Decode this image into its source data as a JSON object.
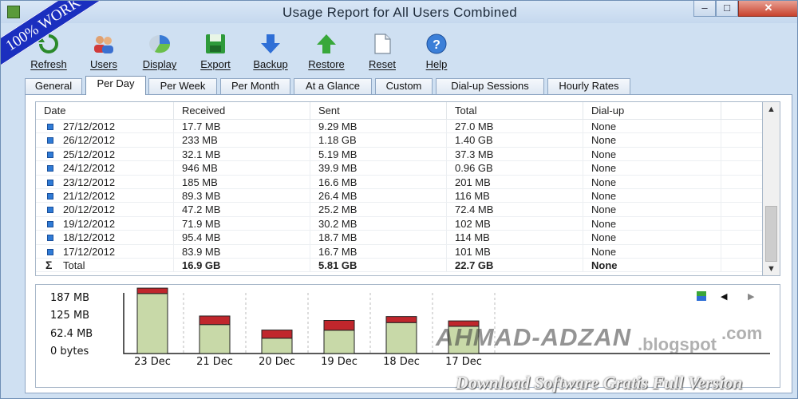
{
  "window": {
    "title": "Usage Report for All Users Combined",
    "min": "–",
    "max": "□",
    "close": "✕"
  },
  "badge": "100% WORK",
  "toolbar": [
    {
      "label": "Refresh",
      "icon": "refresh-icon"
    },
    {
      "label": "Users",
      "icon": "users-icon"
    },
    {
      "label": "Display",
      "icon": "display-icon"
    },
    {
      "label": "Export",
      "icon": "export-icon"
    },
    {
      "label": "Backup",
      "icon": "backup-icon"
    },
    {
      "label": "Restore",
      "icon": "restore-icon"
    },
    {
      "label": "Reset",
      "icon": "reset-icon"
    },
    {
      "label": "Help",
      "icon": "help-icon"
    }
  ],
  "tabs": [
    "General",
    "Per Day",
    "Per Week",
    "Per Month",
    "At a Glance",
    "Custom",
    "Dial-up Sessions",
    "Hourly Rates"
  ],
  "active_tab": "Per Day",
  "table": {
    "columns": [
      "Date",
      "Received",
      "Sent",
      "Total",
      "Dial-up"
    ],
    "rows": [
      [
        "27/12/2012",
        "17.7 MB",
        "9.29 MB",
        "27.0 MB",
        "None"
      ],
      [
        "26/12/2012",
        "233 MB",
        "1.18 GB",
        "1.40 GB",
        "None"
      ],
      [
        "25/12/2012",
        "32.1 MB",
        "5.19 MB",
        "37.3 MB",
        "None"
      ],
      [
        "24/12/2012",
        "946 MB",
        "39.9 MB",
        "0.96 GB",
        "None"
      ],
      [
        "23/12/2012",
        "185 MB",
        "16.6 MB",
        "201 MB",
        "None"
      ],
      [
        "21/12/2012",
        "89.3 MB",
        "26.4 MB",
        "116 MB",
        "None"
      ],
      [
        "20/12/2012",
        "47.2 MB",
        "25.2 MB",
        "72.4 MB",
        "None"
      ],
      [
        "19/12/2012",
        "71.9 MB",
        "30.2 MB",
        "102 MB",
        "None"
      ],
      [
        "18/12/2012",
        "95.4 MB",
        "18.7 MB",
        "114 MB",
        "None"
      ],
      [
        "17/12/2012",
        "83.9 MB",
        "16.7 MB",
        "101 MB",
        "None"
      ]
    ],
    "total": [
      "Total",
      "16.9 GB",
      "5.81 GB",
      "22.7 GB",
      "None"
    ]
  },
  "chart_data": {
    "type": "bar",
    "categories": [
      "23 Dec",
      "21 Dec",
      "20 Dec",
      "19 Dec",
      "18 Dec",
      "17 Dec"
    ],
    "series": [
      {
        "values": [
          185,
          89.3,
          47.2,
          71.9,
          95.4,
          83.9
        ],
        "color": "#c8d9a8"
      },
      {
        "values": [
          16.6,
          26.4,
          25.2,
          30.2,
          18.7,
          16.7
        ],
        "color": "#c0262c"
      }
    ],
    "yticks": [
      "187 MB",
      "125 MB",
      "62.4 MB",
      "0 bytes"
    ],
    "ylim": [
      0,
      187
    ],
    "grid": "vertical dashed"
  },
  "watermark": {
    "brand": "AHMAD-ADZAN",
    "domain": ".blogspot",
    "tld": ".com",
    "tagline": "Download Software Gratis Full Version"
  }
}
